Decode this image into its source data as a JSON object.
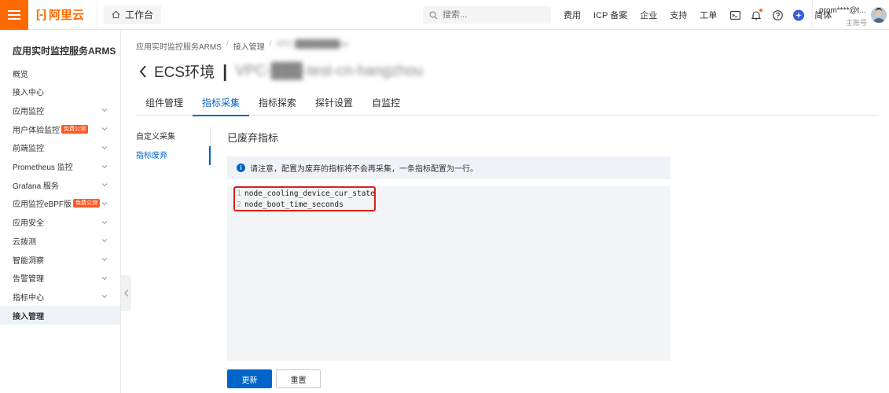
{
  "topbar": {
    "logo_text": "阿里云",
    "workbench_label": "工作台",
    "search_placeholder": "搜索...",
    "links": [
      "费用",
      "ICP 备案",
      "企业",
      "支持",
      "工单"
    ],
    "lang": "简体",
    "user_name": "prom****@t...",
    "user_role": "主账号"
  },
  "sidebar": {
    "title": "应用实时监控服务ARMS",
    "items": [
      {
        "label": "概览",
        "expandable": false,
        "badge": ""
      },
      {
        "label": "接入中心",
        "expandable": false,
        "badge": ""
      },
      {
        "label": "应用监控",
        "expandable": true,
        "badge": ""
      },
      {
        "label": "用户体验监控",
        "expandable": true,
        "badge": "免费公测"
      },
      {
        "label": "前端监控",
        "expandable": true,
        "badge": ""
      },
      {
        "label": "Prometheus 监控",
        "expandable": true,
        "badge": ""
      },
      {
        "label": "Grafana 服务",
        "expandable": true,
        "badge": ""
      },
      {
        "label": "应用监控eBPF版",
        "expandable": true,
        "badge": "免费公测"
      },
      {
        "label": "应用安全",
        "expandable": true,
        "badge": ""
      },
      {
        "label": "云拨测",
        "expandable": true,
        "badge": ""
      },
      {
        "label": "智能洞察",
        "expandable": true,
        "badge": ""
      },
      {
        "label": "告警管理",
        "expandable": true,
        "badge": ""
      },
      {
        "label": "指标中心",
        "expandable": true,
        "badge": ""
      },
      {
        "label": "接入管理",
        "expandable": false,
        "badge": "",
        "active": true
      }
    ]
  },
  "breadcrumb": [
    "应用实时监控服务ARMS",
    "接入管理",
    "VPC-████████ou"
  ],
  "header": {
    "title": "ECS环境",
    "divider": "|",
    "vpc_name": "VPC-███-test-cn-hangzhou"
  },
  "tabs": [
    {
      "label": "组件管理",
      "active": false
    },
    {
      "label": "指标采集",
      "active": true
    },
    {
      "label": "指标探索",
      "active": false
    },
    {
      "label": "探针设置",
      "active": false
    },
    {
      "label": "自监控",
      "active": false
    }
  ],
  "subnav": [
    {
      "label": "自定义采集",
      "active": false
    },
    {
      "label": "指标废弃",
      "active": true
    }
  ],
  "content": {
    "section_title": "已废弃指标",
    "notice": "请注意，配置为废弃的指标将不会再采集，一条指标配置为一行。",
    "code_lines": [
      {
        "no": "1",
        "text": "node_cooling_device_cur_state"
      },
      {
        "no": "2",
        "text": "node_boot_time_seconds"
      }
    ]
  },
  "buttons": {
    "update": "更新",
    "reset": "重置"
  },
  "colors": {
    "brand": "#ff6a00",
    "primary": "#0064c8",
    "highlight": "#d9201c"
  }
}
